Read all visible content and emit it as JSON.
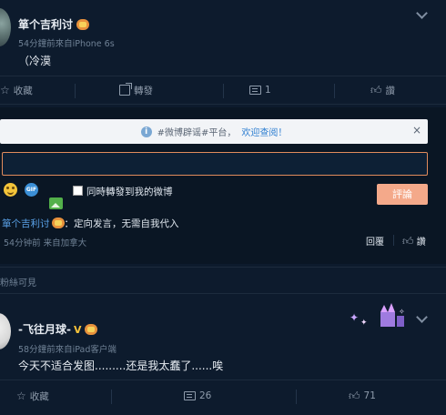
{
  "post1": {
    "username": "箪个吉利讨",
    "meta": "54分鐘前來自iPhone 6s",
    "text": "（冷漠"
  },
  "actions1": {
    "favorite": "收藏",
    "repost": "轉發",
    "comment_count": "1",
    "like": "讚"
  },
  "notice": {
    "hashtag_text": "#微博辟谣#平台，",
    "link_text": "欢迎查阅！",
    "close_glyph": "×"
  },
  "composer": {
    "input_value": "",
    "checkbox_label": "同時轉發到我的微博",
    "submit_label": "評論",
    "gif_text": "GIF"
  },
  "reply": {
    "username": "箪个吉利讨",
    "text": "：定向发言，无需自我代入",
    "meta": "54分钟前 来自加拿大",
    "reply_label": "回覆",
    "like_label": "讚"
  },
  "section": {
    "label": "粉絲可見"
  },
  "post2": {
    "username": "-飞往月球-",
    "v_badge": "V",
    "meta": "58分鐘前來自iPad客户端",
    "text": "今天不适合发图.........还是我太蠢了......唉"
  },
  "actions2": {
    "favorite": "收藏",
    "comment_count": "26",
    "like_count": "71"
  },
  "colors": {
    "background": "#0d1b2d",
    "accent_orange": "#e18b5c",
    "link_blue": "#5aa2e8",
    "submit_bg": "#f4a98a"
  }
}
